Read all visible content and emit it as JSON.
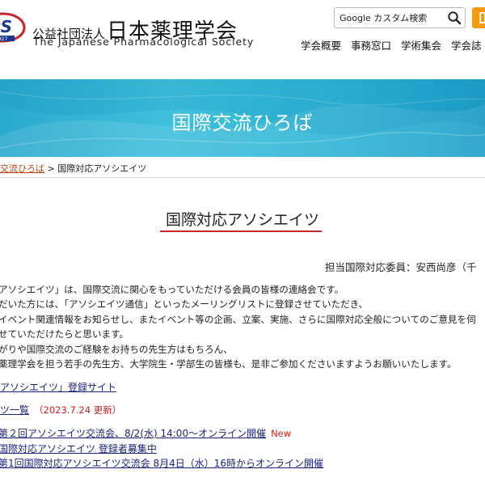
{
  "header": {
    "logo_est": "1927",
    "org_prefix": "公益社団法人",
    "org_name": "日本薬理学会",
    "org_name_en": "The Japanese Pharmacological Society",
    "search_placeholder": "Google カスタム検索",
    "nav": [
      "学会概要",
      "事務窓口",
      "学術集会",
      "学会誌"
    ]
  },
  "banner": {
    "title": "国際交流ひろば"
  },
  "breadcrumb": {
    "parent": "交流ひろば",
    "sep": " > ",
    "current": "国際対応アソシエイツ"
  },
  "page": {
    "title": "国際対応アソシエイツ",
    "officer": "担当国際対応委員：安西尚彦（千",
    "body": [
      "アソシエイツ」は、国際交流に関心をもっていただける会員の皆様の連絡会です。",
      "だいた方には、「アソシエイツ通信」といったメーリングリストに登録させていただき、",
      "イベント関連情報をお知らせし、またイベント等の企画、立案、実施、さらに国際対応全般についてのご意見を伺",
      "せていただけたらと思います。",
      "がりや国際交流のご経験をお持ちの先生方はもちろん、",
      "薬理学会を担う若手の先生方、大学院生・学部生の皆様も、是非ご参加くださいますようお願いいたします。"
    ],
    "register_link": "アソシエイツ」登録サイト",
    "list_link": "ツ一覧",
    "list_updated": "（2023.7.24 更新）",
    "news": [
      {
        "text": "第２回アソシエイツ交流会、8/2(水) 14:00〜オンライン開催",
        "badge": "New"
      },
      {
        "text": "国際対応アソシエイツ 登録者募集中",
        "badge": ""
      },
      {
        "text": "第1回国際対応アソシエイツ交流会 8月4日（水）16時からオンライン開催",
        "badge": ""
      }
    ]
  },
  "colors": {
    "accent": "#c62828",
    "banner": "#2fb3d6",
    "link": "#1a237e",
    "search_button": "#f39c12"
  }
}
